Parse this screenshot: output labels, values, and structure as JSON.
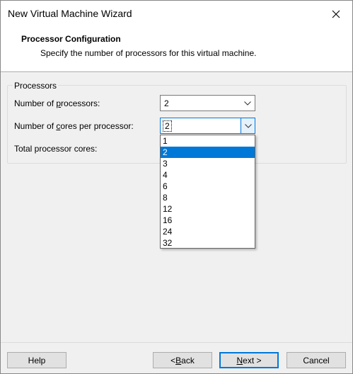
{
  "window": {
    "title": "New Virtual Machine Wizard",
    "close_icon": "close-icon"
  },
  "header": {
    "title": "Processor Configuration",
    "subtitle": "Specify the number of processors for this virtual machine."
  },
  "processors": {
    "legend": "Processors",
    "num_processors": {
      "label_pre": "Number of ",
      "label_key": "p",
      "label_post": "rocessors:",
      "value": "2"
    },
    "cores_per_processor": {
      "label_pre": "Number of ",
      "label_key": "c",
      "label_post": "ores per processor:",
      "value": "2"
    },
    "total_cores": {
      "label": "Total processor cores:"
    }
  },
  "dropdown": {
    "options": [
      "1",
      "2",
      "3",
      "4",
      "6",
      "8",
      "12",
      "16",
      "24",
      "32"
    ],
    "selected": "2",
    "selection_color": "#0078d7"
  },
  "buttons": {
    "help": "Help",
    "back_pre": "< ",
    "back_key": "B",
    "back_post": "ack",
    "next_key": "N",
    "next_post": "ext >",
    "cancel": "Cancel"
  }
}
